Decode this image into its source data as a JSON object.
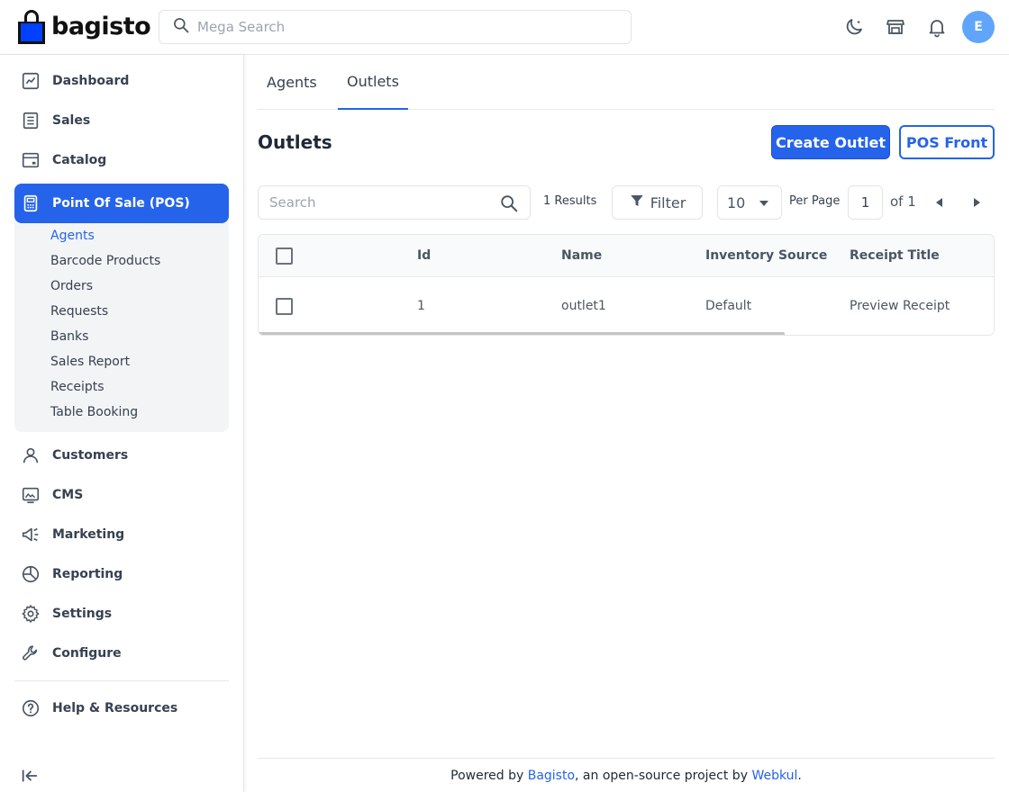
{
  "app": {
    "logo_text": "bagisto"
  },
  "header": {
    "search_placeholder": "Mega Search",
    "avatar_initial": "E"
  },
  "sidebar": {
    "items_top": [
      {
        "label": "Dashboard",
        "icon": "dashboard-icon"
      },
      {
        "label": "Sales",
        "icon": "sales-icon"
      },
      {
        "label": "Catalog",
        "icon": "catalog-icon"
      }
    ],
    "pos": {
      "label": "Point Of Sale (POS)",
      "icon": "pos-icon",
      "children": [
        "Agents",
        "Barcode Products",
        "Orders",
        "Requests",
        "Banks",
        "Sales Report",
        "Receipts",
        "Table Booking"
      ],
      "active_child": "Agents"
    },
    "items_bottom": [
      {
        "label": "Customers",
        "icon": "customers-icon"
      },
      {
        "label": "CMS",
        "icon": "cms-icon"
      },
      {
        "label": "Marketing",
        "icon": "marketing-icon"
      },
      {
        "label": "Reporting",
        "icon": "reporting-icon"
      },
      {
        "label": "Settings",
        "icon": "settings-icon"
      },
      {
        "label": "Configure",
        "icon": "configure-icon"
      }
    ],
    "help": {
      "label": "Help & Resources",
      "icon": "help-icon"
    }
  },
  "tabs": [
    {
      "label": "Agents",
      "active": false
    },
    {
      "label": "Outlets",
      "active": true
    }
  ],
  "page": {
    "title": "Outlets",
    "create_button": "Create Outlet",
    "pos_front_button": "POS Front"
  },
  "grid": {
    "search_placeholder": "Search",
    "results": "1 Results",
    "filter_label": "Filter",
    "per_page_value": "10",
    "per_page_label": "Per Page",
    "current_page": "1",
    "of_pages": "of 1",
    "columns": [
      "Id",
      "Name",
      "Inventory Source",
      "Receipt Title"
    ],
    "rows": [
      {
        "id": "1",
        "name": "outlet1",
        "inventory_source": "Default",
        "receipt_title": "Preview Receipt"
      }
    ]
  },
  "footer": {
    "prefix": "Powered by ",
    "link1": "Bagisto",
    "middle": ", an open-source project by ",
    "link2": "Webkul",
    "suffix": "."
  },
  "colors": {
    "accent": "#2563eb",
    "avatar": "#60a5fa",
    "logo_blue": "#0041ff"
  }
}
